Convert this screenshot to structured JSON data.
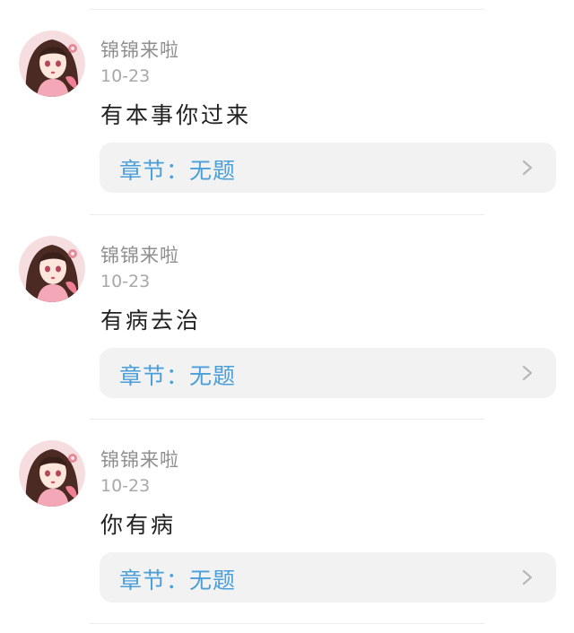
{
  "comments": [
    {
      "username": "锦锦来啦",
      "date": "10-23",
      "content": "有本事你过来",
      "chapter_label": "章节：无题"
    },
    {
      "username": "锦锦来啦",
      "date": "10-23",
      "content": "有病去治",
      "chapter_label": "章节：无题"
    },
    {
      "username": "锦锦来啦",
      "date": "10-23",
      "content": "你有病",
      "chapter_label": "章节：无题"
    }
  ],
  "colors": {
    "chapter_link": "#4a9fd8",
    "card_background": "#f2f2f2",
    "username": "#8e8e8e",
    "date": "#a8a8a8",
    "content": "#222222"
  }
}
